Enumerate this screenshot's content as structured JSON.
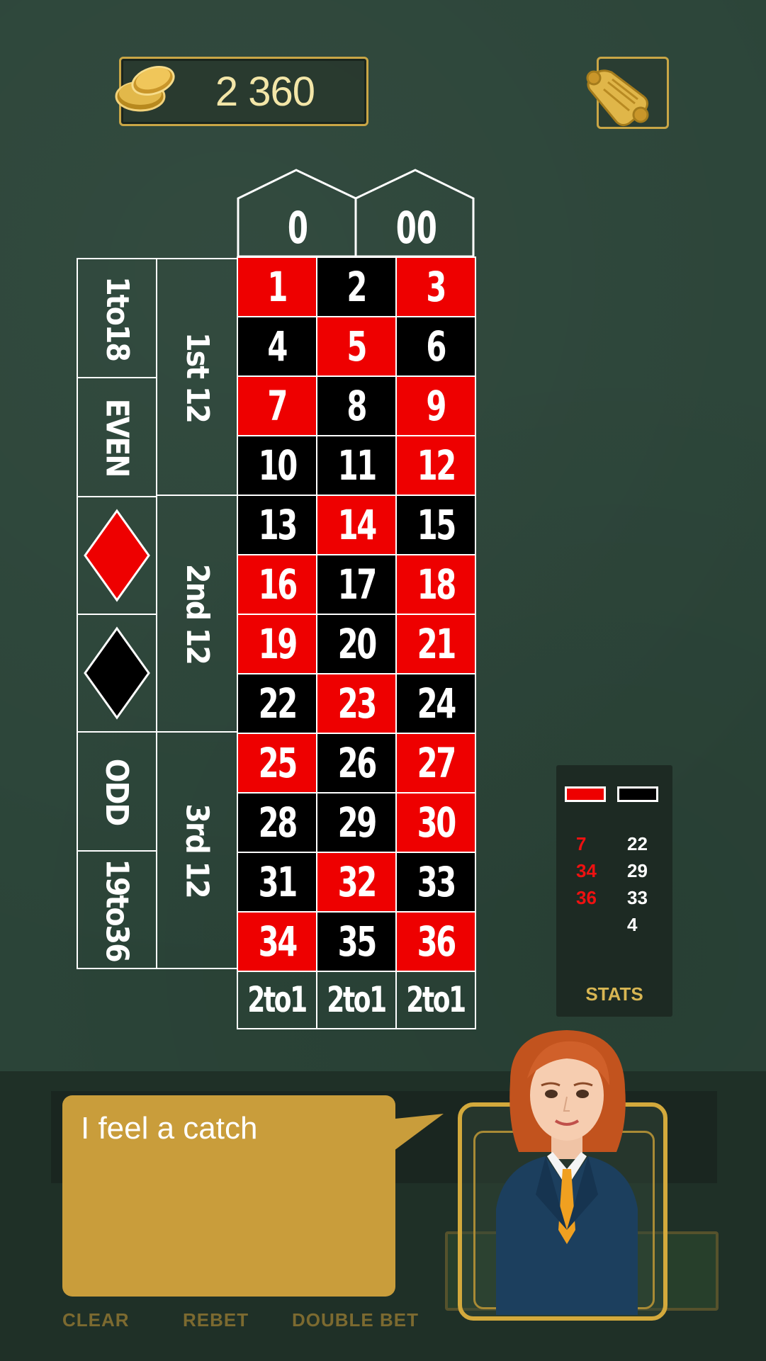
{
  "header": {
    "balance": "2 360",
    "coin_icon": "gold-coins-icon",
    "history_icon": "scroll-icon"
  },
  "table": {
    "zeros": [
      "0",
      "00"
    ],
    "rows": [
      [
        {
          "n": "1",
          "c": "red"
        },
        {
          "n": "2",
          "c": "black"
        },
        {
          "n": "3",
          "c": "red"
        }
      ],
      [
        {
          "n": "4",
          "c": "black"
        },
        {
          "n": "5",
          "c": "red"
        },
        {
          "n": "6",
          "c": "black"
        }
      ],
      [
        {
          "n": "7",
          "c": "red"
        },
        {
          "n": "8",
          "c": "black"
        },
        {
          "n": "9",
          "c": "red"
        }
      ],
      [
        {
          "n": "10",
          "c": "black"
        },
        {
          "n": "11",
          "c": "black"
        },
        {
          "n": "12",
          "c": "red"
        }
      ],
      [
        {
          "n": "13",
          "c": "black"
        },
        {
          "n": "14",
          "c": "red"
        },
        {
          "n": "15",
          "c": "black"
        }
      ],
      [
        {
          "n": "16",
          "c": "red"
        },
        {
          "n": "17",
          "c": "black"
        },
        {
          "n": "18",
          "c": "red"
        }
      ],
      [
        {
          "n": "19",
          "c": "red"
        },
        {
          "n": "20",
          "c": "black"
        },
        {
          "n": "21",
          "c": "red"
        }
      ],
      [
        {
          "n": "22",
          "c": "black"
        },
        {
          "n": "23",
          "c": "red"
        },
        {
          "n": "24",
          "c": "black"
        }
      ],
      [
        {
          "n": "25",
          "c": "red"
        },
        {
          "n": "26",
          "c": "black"
        },
        {
          "n": "27",
          "c": "red"
        }
      ],
      [
        {
          "n": "28",
          "c": "black"
        },
        {
          "n": "29",
          "c": "black"
        },
        {
          "n": "30",
          "c": "red"
        }
      ],
      [
        {
          "n": "31",
          "c": "black"
        },
        {
          "n": "32",
          "c": "red"
        },
        {
          "n": "33",
          "c": "black"
        }
      ],
      [
        {
          "n": "34",
          "c": "red"
        },
        {
          "n": "35",
          "c": "black"
        },
        {
          "n": "36",
          "c": "red"
        }
      ]
    ],
    "columns_bets": [
      "2to1",
      "2to1",
      "2to1"
    ],
    "dozens": [
      "1st 12",
      "2nd 12",
      "3rd 12"
    ],
    "outside": [
      "1to18",
      "EVEN",
      "red-diamond",
      "black-diamond",
      "ODD",
      "19to36"
    ]
  },
  "stats": {
    "red_numbers": [
      "7",
      "34",
      "36"
    ],
    "black_numbers": [
      "22",
      "29",
      "33",
      "4"
    ],
    "label": "STATS"
  },
  "controls": {
    "clear": "CLEAR",
    "rebet": "REBET",
    "double_bet": "DOUBLE BET"
  },
  "dealer": {
    "speech": "I feel a catch"
  },
  "colors": {
    "felt": "#2b4438",
    "red": "#ee0000",
    "gold": "#c9a646",
    "bubble": "#c99d3b"
  }
}
